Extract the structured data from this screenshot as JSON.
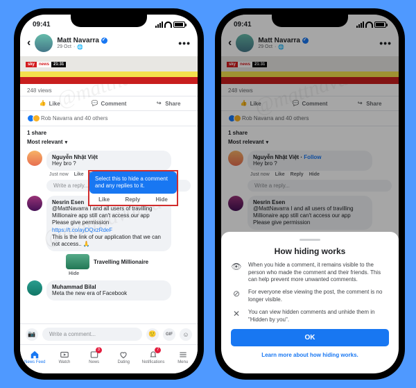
{
  "status": {
    "time": "09:41"
  },
  "post": {
    "author": "Matt Navarra",
    "date": "29 Oct",
    "views": "248 views",
    "sky_label": "sky",
    "sky_news": "news",
    "sky_time": "21:31"
  },
  "actions": {
    "like": "Like",
    "comment": "Comment",
    "share": "Share"
  },
  "reactions": {
    "text": "Rob Navarra and 40 others"
  },
  "share_count": "1 share",
  "sort": "Most relevant",
  "comments": {
    "c1": {
      "name": "Nguyễn Nhật Việt",
      "follow": "Follow",
      "text": "Hey bro ?",
      "time": "Just now",
      "like": "Like",
      "reply": "Reply",
      "hide": "Hide"
    },
    "reply_placeholder": "Write a reply...",
    "c2": {
      "name": "Nesrin Esen",
      "line1": "@MattNavarra I and all users of travilling Millionaire app still can't access our app Please give permission",
      "link": "https://t.co/ayDQxzRdeF",
      "line2": "This is the link of our application that we can not access.. 🙏",
      "nested_title": "Travelling Millionaire",
      "hide": "Hide"
    },
    "c3": {
      "name": "Muhammad Bilal",
      "text": "Meta the new era of Facebook"
    }
  },
  "compose_placeholder": "Write a comment...",
  "gif_label": "GIF",
  "tabs": {
    "feed": "News Feed",
    "watch": "Watch",
    "news": "News",
    "dating": "Dating",
    "notif": "Notifications",
    "menu": "Menu",
    "badge_news": "3",
    "badge_notif": "7"
  },
  "tooltip": {
    "text": "Select this to hide a comment and any replies to it.",
    "like": "Like",
    "reply": "Reply",
    "hide": "Hide"
  },
  "sheet": {
    "title": "How hiding works",
    "row1": "When you hide a comment, it remains visible to the person who made the comment and their friends. This can help prevent more unwanted comments.",
    "row2": "For everyone else viewing the post, the comment is no longer visible.",
    "row3": "You can view hidden comments and unhide them in \"Hidden by you\".",
    "ok": "OK",
    "learn": "Learn more about how hiding works."
  },
  "watermark": "@mattnavarra"
}
